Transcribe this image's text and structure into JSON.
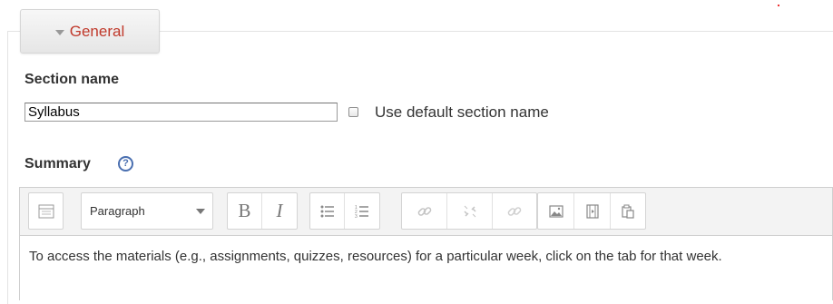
{
  "section": {
    "legend": "General"
  },
  "section_name": {
    "label": "Section name",
    "value": "Syllabus",
    "checkbox_label": "Use default section name",
    "checkbox_checked": false
  },
  "summary": {
    "label": "Summary",
    "help_icon": "question-circle-icon"
  },
  "editor": {
    "toolbar": {
      "toggle_icon": "toolbar-toggle-icon",
      "format_select": "Paragraph",
      "bold": "B",
      "italic": "I",
      "buttons": [
        "bold",
        "italic",
        "unordered-list",
        "ordered-list",
        "link",
        "unlink",
        "insert-link",
        "image",
        "media",
        "paste"
      ]
    },
    "content": "To access the materials (e.g., assignments, quizzes, resources) for a particular week, click on the tab for that week."
  },
  "colors": {
    "legend_text": "#c0392b",
    "help_icon": "#4a6fb0"
  }
}
